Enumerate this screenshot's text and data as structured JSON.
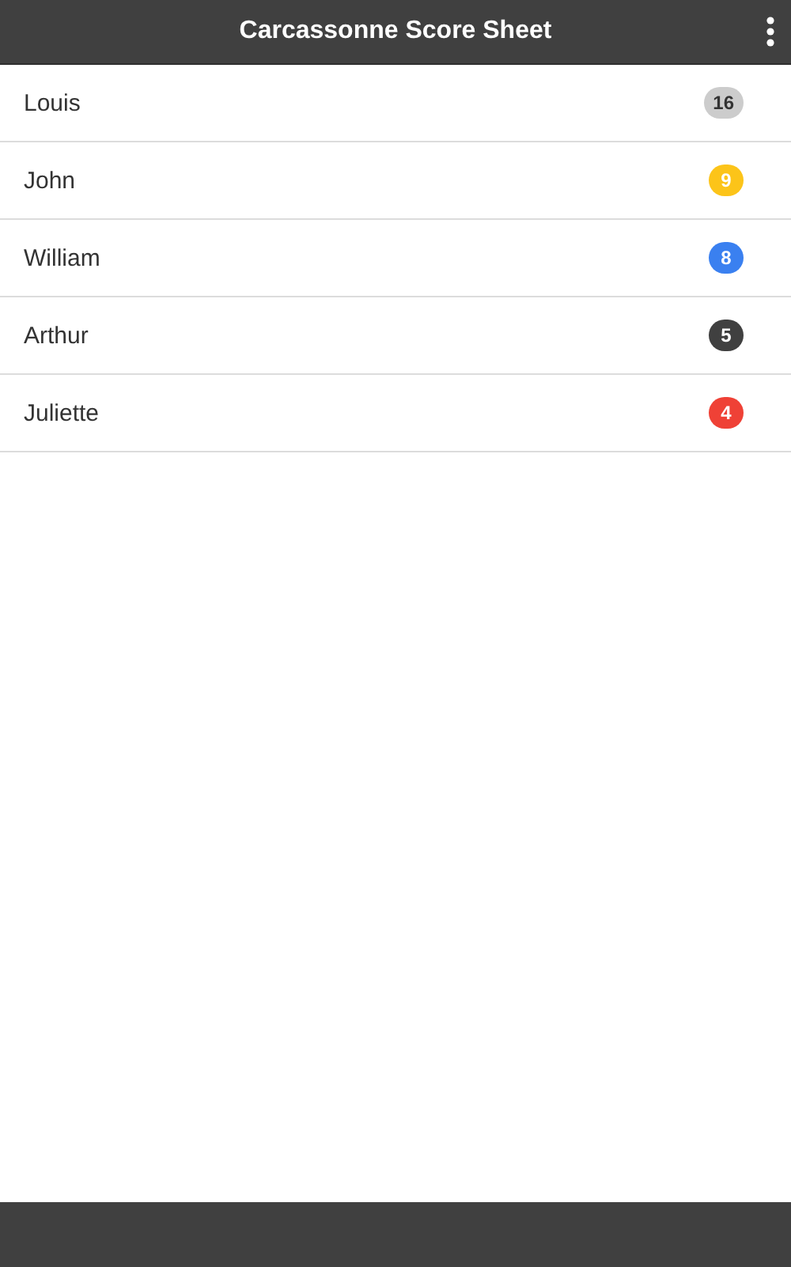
{
  "header": {
    "title": "Carcassonne Score Sheet"
  },
  "players": [
    {
      "name": "Louis",
      "score": "16",
      "color": "#cccccc"
    },
    {
      "name": "John",
      "score": "9",
      "color": "#fcc419"
    },
    {
      "name": "William",
      "score": "8",
      "color": "#3a80f0"
    },
    {
      "name": "Arthur",
      "score": "5",
      "color": "#404040"
    },
    {
      "name": "Juliette",
      "score": "4",
      "color": "#ef4136"
    }
  ]
}
